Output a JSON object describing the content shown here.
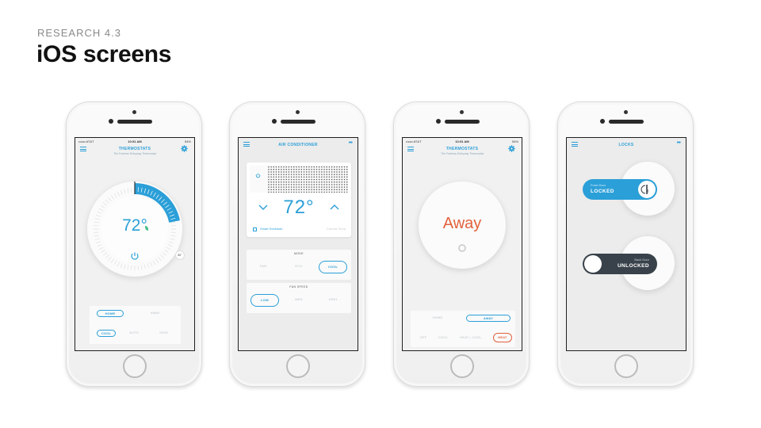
{
  "header": {
    "eyebrow": "RESEARCH 4.3",
    "title": "iOS screens"
  },
  "colors": {
    "accent_blue": "#2b9fd8",
    "accent_orange": "#e2613c",
    "dark_toggle": "#39424a"
  },
  "status_bar": {
    "carrier": "•••oo AT&T",
    "time": "10:51 AM",
    "battery": "54%"
  },
  "thermostat_screen": {
    "title": "THERMOSTATS",
    "subtitle": "The Fortress Entryway Thermostat",
    "temperature": "72°",
    "setpoint": "80°",
    "setpoint_fraction": 0.22,
    "location_options": [
      "HOME",
      "AWAY"
    ],
    "location_selected": "HOME",
    "mode_options": [
      "COOL",
      "AUTO",
      "HEAT"
    ],
    "mode_selected": "COOL"
  },
  "ac_screen": {
    "title": "AIR CONDITIONER",
    "temperature": "72°",
    "schedule_label": "Smart Schedule",
    "current_label": "Current Temp",
    "mode_label": "MODE",
    "mode_options": [
      "FAN",
      "ECO",
      "COOL"
    ],
    "mode_selected": "COOL",
    "fan_speed_label": "FAN SPEED",
    "fan_options": [
      "LOW",
      "MED",
      "HIGH"
    ],
    "fan_selected": "LOW"
  },
  "away_screen": {
    "title": "THERMOSTATS",
    "subtitle": "The Fortress Entryway Thermostat",
    "status": "Away",
    "location_options": [
      "HOME",
      "AWAY"
    ],
    "location_selected": "AWAY",
    "mode_options": [
      "OFF",
      "COOL",
      "HEAT • COOL",
      "HEAT"
    ],
    "mode_selected": "HEAT"
  },
  "locks_screen": {
    "title": "LOCKS",
    "front_door": {
      "name": "Front Door",
      "state": "LOCKED"
    },
    "back_door": {
      "name": "Back Door",
      "state": "UNLOCKED"
    }
  }
}
